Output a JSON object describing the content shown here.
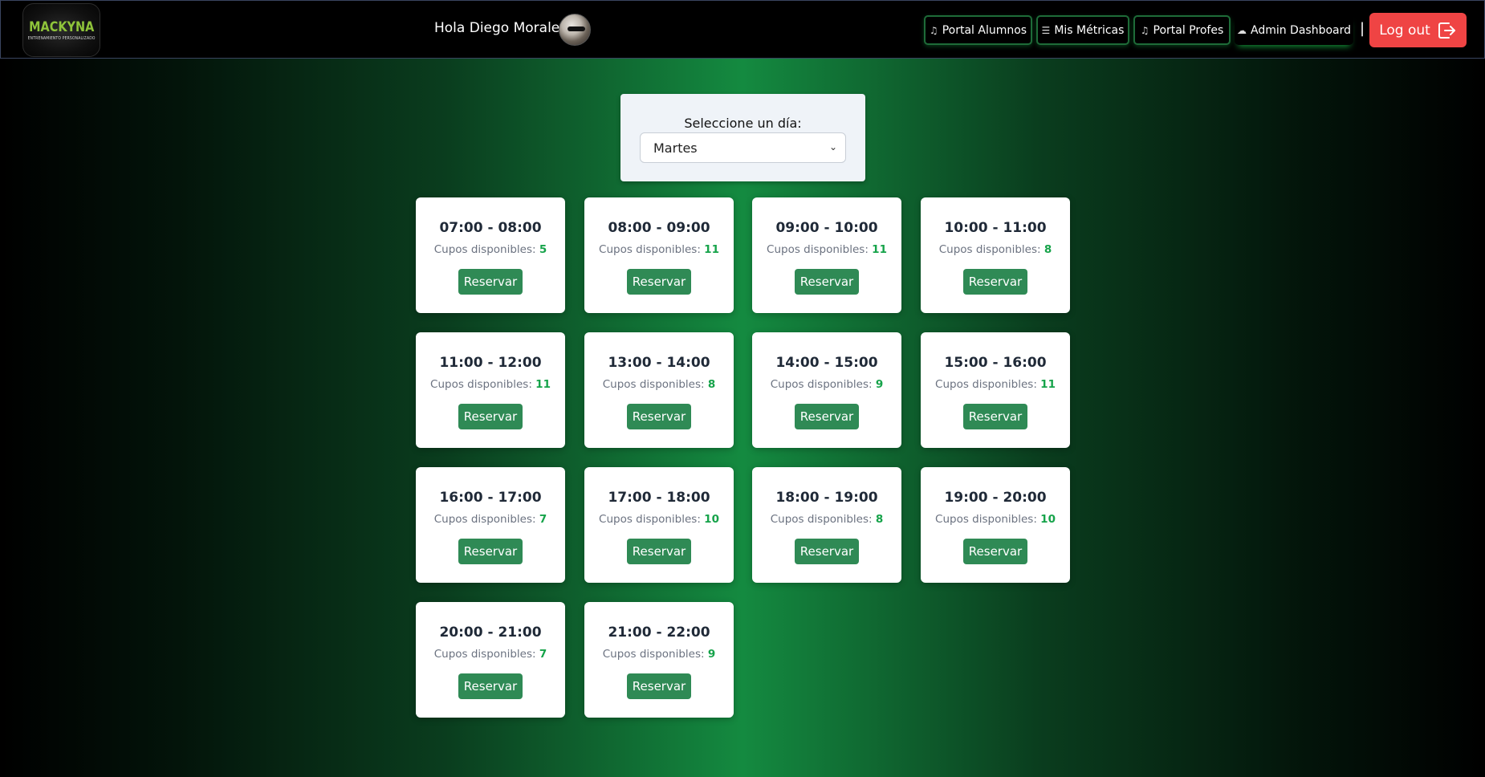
{
  "logo": {
    "name": "MACKYNA",
    "tagline": "ENTRENAMIENTO PERSONALIZADO"
  },
  "header": {
    "greeting": "Hola Diego Morales!",
    "nav": [
      {
        "label": "Portal Alumnos",
        "icon": "music-note-icon"
      },
      {
        "label": "Mis Métricas",
        "icon": "list-icon"
      },
      {
        "label": "Portal Profes",
        "icon": "music-note-icon"
      },
      {
        "label": "Admin Dashboard",
        "icon": "cloud-icon"
      }
    ],
    "separator": "|",
    "logout_label": "Log out"
  },
  "day_selector": {
    "label": "Seleccione un día:",
    "selected": "Martes"
  },
  "slots": {
    "cupos_label": "Cupos disponibles:",
    "button_label": "Reservar",
    "items": [
      {
        "time": "07:00 - 08:00",
        "cupos": "5"
      },
      {
        "time": "08:00 - 09:00",
        "cupos": "11"
      },
      {
        "time": "09:00 - 10:00",
        "cupos": "11"
      },
      {
        "time": "10:00 - 11:00",
        "cupos": "8"
      },
      {
        "time": "11:00 - 12:00",
        "cupos": "11"
      },
      {
        "time": "13:00 - 14:00",
        "cupos": "8"
      },
      {
        "time": "14:00 - 15:00",
        "cupos": "9"
      },
      {
        "time": "15:00 - 16:00",
        "cupos": "11"
      },
      {
        "time": "16:00 - 17:00",
        "cupos": "7"
      },
      {
        "time": "17:00 - 18:00",
        "cupos": "10"
      },
      {
        "time": "18:00 - 19:00",
        "cupos": "8"
      },
      {
        "time": "19:00 - 20:00",
        "cupos": "10"
      },
      {
        "time": "20:00 - 21:00",
        "cupos": "7"
      },
      {
        "time": "21:00 - 22:00",
        "cupos": "9"
      }
    ]
  },
  "colors": {
    "accent_green": "#2f8a55",
    "cupos_green": "#16a34a",
    "logout_red": "#ef4444",
    "logo_green": "#8fc43a"
  }
}
